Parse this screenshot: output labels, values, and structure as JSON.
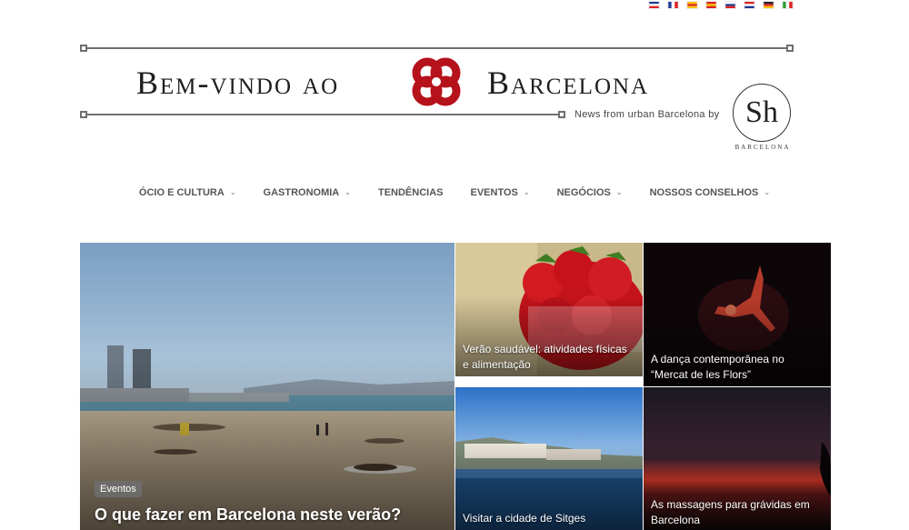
{
  "languages": [
    {
      "name": "english-flag",
      "colors": [
        "#1f3a93",
        "#ffffff",
        "#d22"
      ]
    },
    {
      "name": "french-flag",
      "colors": [
        "#1f3a93",
        "#ffffff",
        "#d22"
      ]
    },
    {
      "name": "catalan-flag",
      "colors": [
        "#f7c300",
        "#d22",
        "#f7c300"
      ]
    },
    {
      "name": "spanish-flag",
      "colors": [
        "#d22",
        "#f7c300",
        "#d22"
      ]
    },
    {
      "name": "russian-flag",
      "colors": [
        "#ffffff",
        "#1f3a93",
        "#d22"
      ]
    },
    {
      "name": "dutch-flag",
      "colors": [
        "#d22",
        "#ffffff",
        "#1f3a93"
      ]
    },
    {
      "name": "german-flag",
      "colors": [
        "#222222",
        "#d22",
        "#f7c300"
      ]
    },
    {
      "name": "italian-flag",
      "colors": [
        "#2a9d3a",
        "#ffffff",
        "#d22"
      ]
    }
  ],
  "header": {
    "title_left": "Bem-vindo ao",
    "title_right": "Barcelona",
    "tagline": "News from urban Barcelona by",
    "logo_letters": "Sh",
    "logo_sub": "BARCELONA",
    "logo_color": "#b5121b"
  },
  "nav": [
    {
      "label": "Ócio e cultura",
      "dropdown": true
    },
    {
      "label": "Gastronomia",
      "dropdown": true
    },
    {
      "label": "Tendências",
      "dropdown": false
    },
    {
      "label": "Eventos",
      "dropdown": true
    },
    {
      "label": "Negócios",
      "dropdown": true
    },
    {
      "label": "Nossos conselhos",
      "dropdown": true
    }
  ],
  "articles": {
    "featured": {
      "category": "Eventos",
      "title": "O que fazer em Barcelona neste verão?"
    },
    "strawberries": {
      "title": "Verão saudável: atividades físicas e alimentação"
    },
    "dance": {
      "title": "A dança contemporânea no “Mercat de les Flors”"
    },
    "sitges": {
      "title": "Visitar a cidade de Sitges"
    },
    "massage": {
      "title": "As massagens para grávidas em Barcelona"
    }
  }
}
